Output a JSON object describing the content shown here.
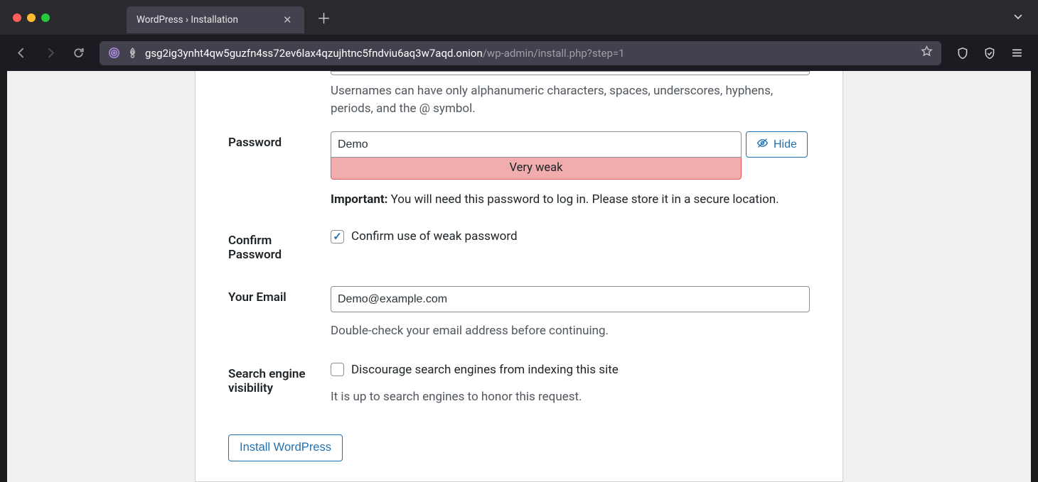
{
  "browser": {
    "tab_title": "WordPress › Installation",
    "url_host": "gsg2ig3ynht4qw5guzfn4ss72ev6lax4qzujhtnc5fndviu6aq3w7aqd.onion",
    "url_path": "/wp-admin/install.php?step=1"
  },
  "form": {
    "username_hint": "Usernames can have only alphanumeric characters, spaces, underscores, hyphens, periods, and the @ symbol.",
    "password": {
      "label": "Password",
      "value": "Demo",
      "hide_label": "Hide",
      "strength_text": "Very weak",
      "important_label": "Important:",
      "important_text": " You will need this password to log in. Please store it in a secure location."
    },
    "confirm": {
      "label": "Confirm Password",
      "checkbox_label": "Confirm use of weak password"
    },
    "email": {
      "label": "Your Email",
      "value": "Demo@example.com",
      "hint": "Double-check your email address before continuing."
    },
    "search_engine": {
      "label": "Search engine visibility",
      "checkbox_label": "Discourage search engines from indexing this site",
      "hint": "It is up to search engines to honor this request."
    },
    "install_button": "Install WordPress"
  }
}
